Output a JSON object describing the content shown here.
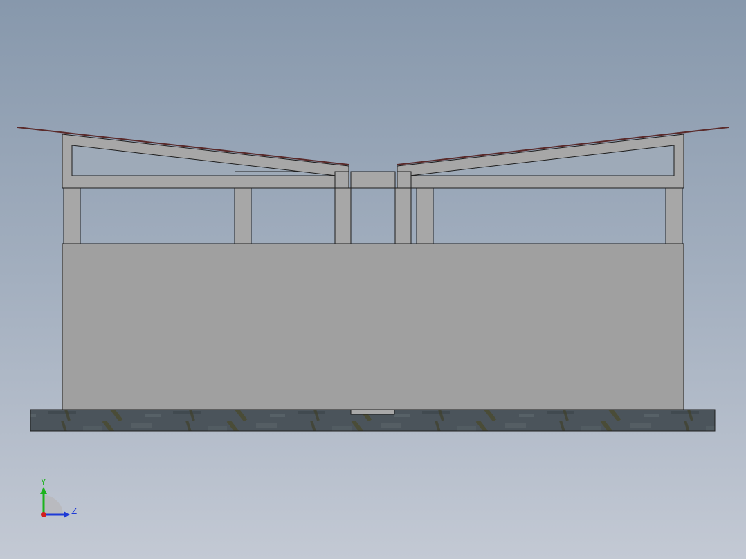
{
  "viewport": {
    "view": "Front",
    "colors": {
      "background_top": "#8798ac",
      "background_bottom": "#c3c9d4",
      "wall": "#a0a0a0",
      "frame": "#a7a7a7",
      "roof_edge": "#5a2a2a",
      "ground": "#4a5258",
      "outline": "#1e1e1e"
    }
  },
  "triad": {
    "y_label": "Y",
    "z_label": "Z",
    "colors": {
      "y_axis": "#1db31d",
      "z_axis": "#1e3ad6",
      "x_axis": "#d21e1e"
    }
  }
}
